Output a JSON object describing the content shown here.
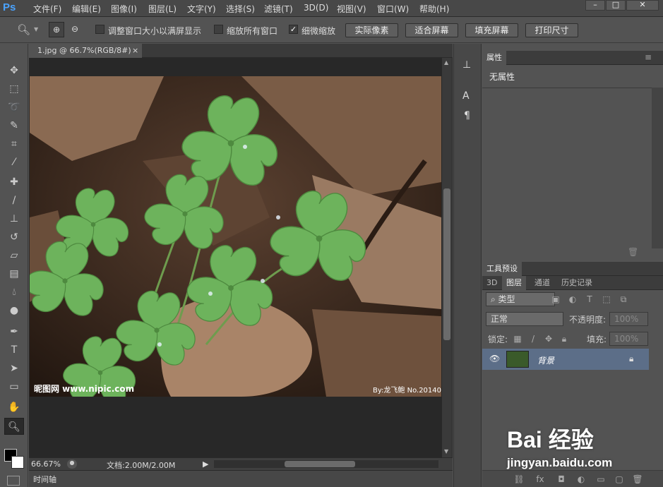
{
  "app": {
    "logo": "Ps"
  },
  "menu": [
    "文件(F)",
    "编辑(E)",
    "图像(I)",
    "图层(L)",
    "文字(Y)",
    "选择(S)",
    "滤镜(T)",
    "3D(D)",
    "视图(V)",
    "窗口(W)",
    "帮助(H)"
  ],
  "window_controls": {
    "minimize": "–",
    "maximize": "□",
    "close": "✕"
  },
  "options": {
    "resize_windows_label": "调整窗口大小以满屏显示",
    "zoom_all_label": "缩放所有窗口",
    "scrubby_zoom_label": "细微缩放",
    "scrubby_checked": "✓",
    "actual_pixels": "实际像素",
    "fit_screen": "适合屏幕",
    "fill_screen": "填充屏幕",
    "print_size": "打印尺寸"
  },
  "document": {
    "tab_title": "1.jpg @ 66.7%(RGB/8#)",
    "tab_close": "×",
    "watermark_left": "昵图网 www.nipic.com",
    "watermark_right": "By:龙飞鲍  No.20140"
  },
  "status": {
    "zoom": "66.67%",
    "doc_size": "文档:2.00M/2.00M"
  },
  "timeline": {
    "label": "时间轴"
  },
  "properties": {
    "tab": "属性",
    "content": "无属性"
  },
  "tool_presets": {
    "tab": "工具预设"
  },
  "layers": {
    "tabs": [
      "3D",
      "图层",
      "通道",
      "历史记录"
    ],
    "filter_kind": "类型",
    "blend_mode": "正常",
    "opacity_label": "不透明度:",
    "opacity_value": "100%",
    "lock_label": "锁定:",
    "fill_label": "填充:",
    "fill_value": "100%",
    "layer_name": "背景"
  },
  "brand_watermark": {
    "text": "Bai 经验",
    "url": "jingyan.baidu.com"
  },
  "colors": {
    "accent": "#4aa3ff",
    "leaf_green": "#6db35c",
    "dry_leaf": "#8a6a52"
  }
}
